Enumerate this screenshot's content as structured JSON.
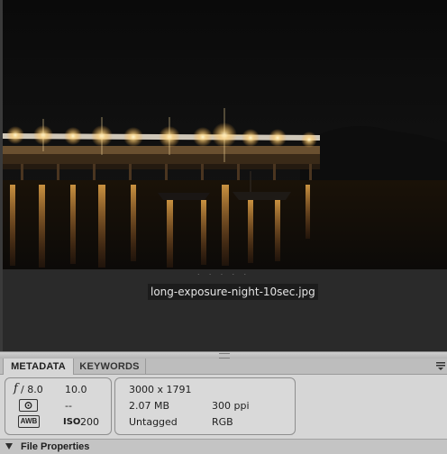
{
  "preview": {
    "image_description_icon": "night-pier-photo",
    "page_dots": "· · · · ·",
    "filename": "long-exposure-night-10sec.jpg"
  },
  "panel": {
    "tabs": [
      {
        "label": "METADATA",
        "active": true
      },
      {
        "label": "KEYWORDS",
        "active": false
      }
    ],
    "menu_icon": "panel-menu-icon"
  },
  "exif": {
    "aperture_symbol": "f",
    "aperture": "/ 8.0",
    "shutter": "10.0",
    "metering_icon": "metering-icon",
    "exposure_comp": "--",
    "white_balance": "AWB",
    "iso_label": "ISO",
    "iso_value": "200"
  },
  "file_info": {
    "dimensions": "3000 x 1791",
    "size": "2.07 MB",
    "resolution": "300 ppi",
    "color_profile": "Untagged",
    "color_mode": "RGB"
  },
  "section": {
    "file_properties_label": "File Properties"
  },
  "colors": {
    "panel_bg": "#d6d6d6",
    "preview_bg": "#2a2a2a",
    "water_light": "#d9a040"
  }
}
